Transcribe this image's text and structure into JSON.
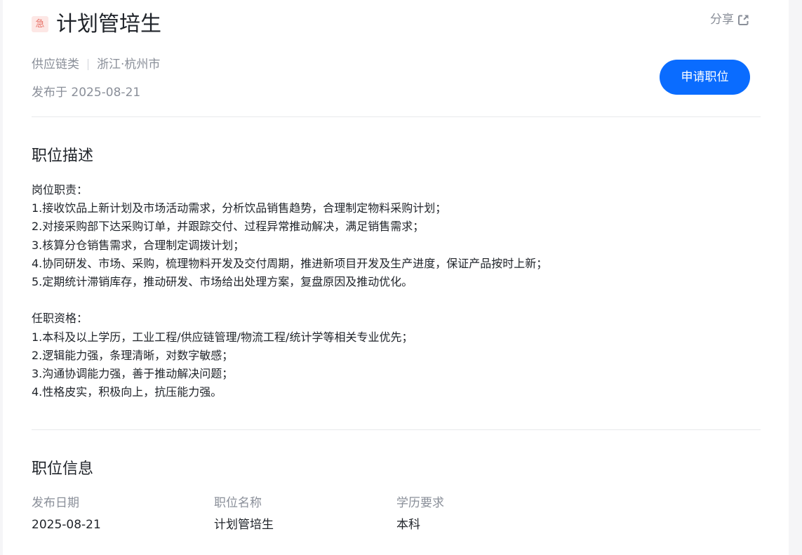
{
  "job": {
    "urgent_badge": "急",
    "title": "计划管培生",
    "category": "供应链类",
    "location": "浙江·杭州市",
    "posted": "发布于 2025-08-21"
  },
  "actions": {
    "share_label": "分享",
    "apply_label": "申请职位",
    "accent_color": "#0a6cff"
  },
  "description": {
    "heading": "职位描述",
    "duties_title": "岗位职责：",
    "duties": [
      "1.接收饮品上新计划及市场活动需求，分析饮品销售趋势，合理制定物料采购计划；",
      "2.对接采购部下达采购订单，并跟踪交付、过程异常推动解决，满足销售需求；",
      "3.核算分仓销售需求，合理制定调拨计划；",
      "4.协同研发、市场、采购，梳理物料开发及交付周期，推进新项目开发及生产进度，保证产品按时上新；",
      "5.定期统计滞销库存，推动研发、市场给出处理方案，复盘原因及推动优化。"
    ],
    "requirements_title": "任职资格：",
    "requirements": [
      "1.本科及以上学历，工业工程/供应链管理/物流工程/统计学等相关专业优先；",
      "2.逻辑能力强，条理清晰，对数字敏感；",
      "3.沟通协调能力强，善于推动解决问题；",
      "4.性格皮实，积极向上，抗压能力强。"
    ]
  },
  "info": {
    "heading": "职位信息",
    "fields": [
      {
        "label": "发布日期",
        "value": "2025-08-21"
      },
      {
        "label": "职位名称",
        "value": "计划管培生"
      },
      {
        "label": "学历要求",
        "value": "本科"
      }
    ]
  }
}
